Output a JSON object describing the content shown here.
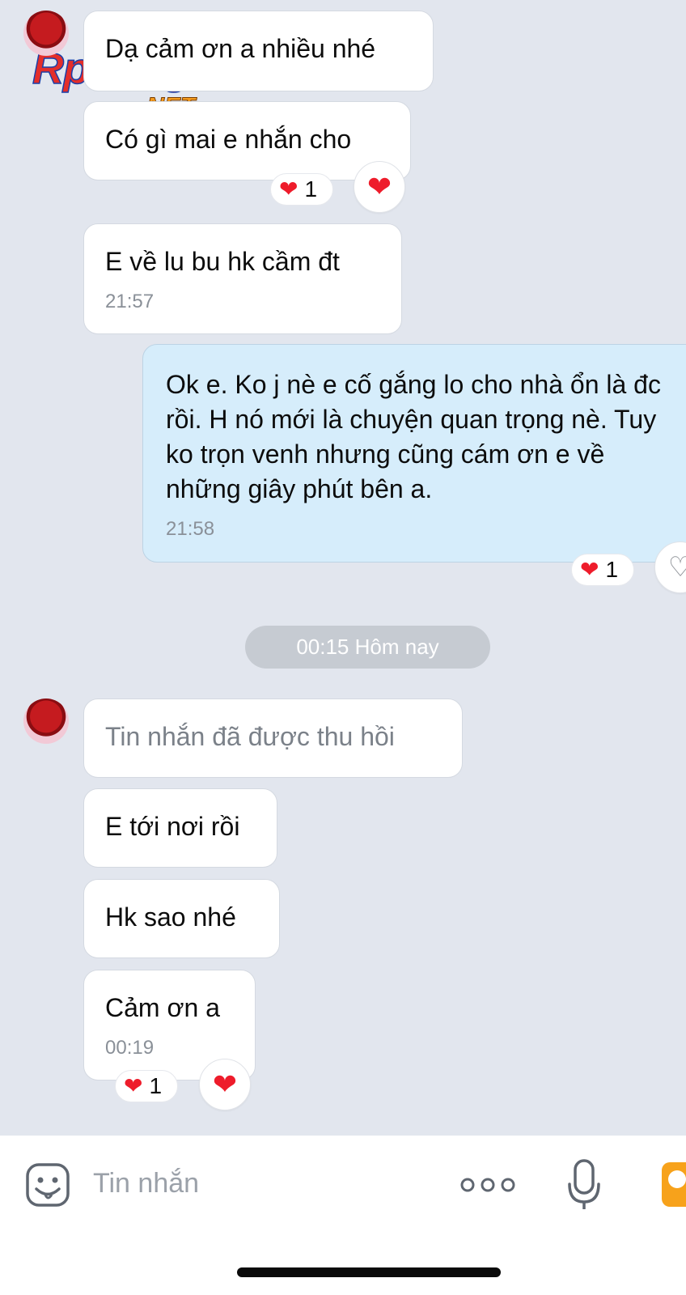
{
  "watermark": {
    "brand": "Rphangs",
    "domain": ".NET"
  },
  "messages": [
    {
      "text": "Dạ cảm ơn a nhiều nhé"
    },
    {
      "text": "Có gì mai e nhắn cho",
      "reaction_count": "1"
    },
    {
      "text": "E về lu bu hk cầm đt",
      "time": "21:57"
    },
    {
      "text": "Ok e. Ko j nè e cố gắng lo cho nhà ổn là đc rồi. H nó mới là chuyện quan trọng nè. Tuy ko trọn venh nhưng cũng cám ơn e về những giây phút bên a.",
      "time": "21:58",
      "reaction_count": "1"
    },
    {
      "text": "Tin nhắn đã được thu hồi"
    },
    {
      "text": "E tới nơi rồi"
    },
    {
      "text": "Hk sao nhé"
    },
    {
      "text": "Cảm ơn a",
      "time": "00:19",
      "reaction_count": "1"
    }
  ],
  "divider": {
    "text": "00:15 Hôm nay"
  },
  "composer": {
    "placeholder": "Tin nhắn"
  },
  "colors": {
    "background": "#e2e6ee",
    "received_bubble": "#ffffff",
    "sent_bubble": "#d6edfb",
    "heart": "#ee1c2b",
    "image_button": "#f7a21b"
  },
  "icons": [
    "heart-icon",
    "heart-outline-icon",
    "sticker-icon",
    "more-options-icon",
    "microphone-icon",
    "image-icon"
  ]
}
